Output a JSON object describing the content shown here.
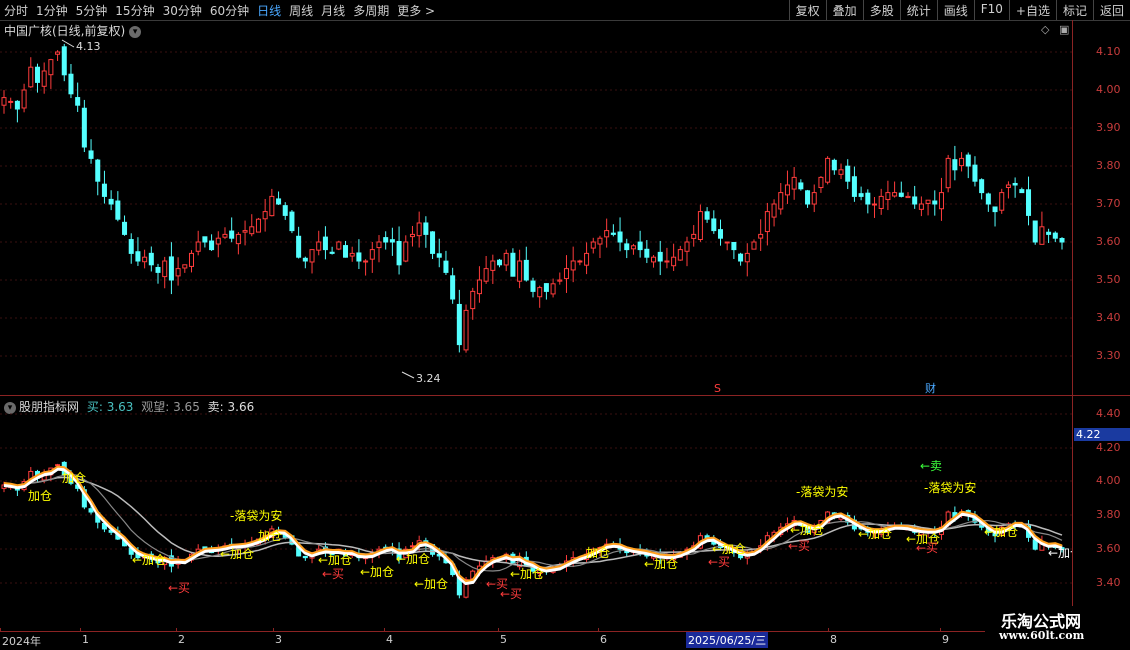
{
  "toolbar": {
    "periods": [
      "分时",
      "1分钟",
      "5分钟",
      "15分钟",
      "30分钟",
      "60分钟",
      "日线",
      "周线",
      "月线",
      "多周期",
      "更多 >"
    ],
    "active": "日线",
    "buttons": [
      "复权",
      "叠加",
      "多股",
      "统计",
      "画线",
      "F10",
      "+自选",
      "标记",
      "返回"
    ]
  },
  "main_panel": {
    "title": "中国广核(日线,前复权)",
    "high_label": "4.13",
    "low_label": "3.24",
    "marker_s": "S",
    "marker_cai": "财",
    "y_ticks": [
      "4.10",
      "4.00",
      "3.90",
      "3.80",
      "3.70",
      "3.60",
      "3.50",
      "3.40",
      "3.30"
    ]
  },
  "indicator_panel": {
    "name": "股朋指标网",
    "buy_label": "买: 3.63",
    "watch_label": "观望: 3.65",
    "sell_label": "卖: 3.66",
    "current_value": "4.22",
    "y_ticks": [
      "4.40",
      "4.20",
      "4.00",
      "3.80",
      "3.60",
      "3.40"
    ],
    "annotations": {
      "jiacang": "加仓",
      "arrow_jiacang": "←加仓",
      "arrow_buy": "←买",
      "arrow_sell": "←卖",
      "bag": "-落袋为安"
    }
  },
  "x_axis": {
    "labels": [
      "2024年",
      "1",
      "2",
      "3",
      "4",
      "5",
      "6",
      "8",
      "9"
    ],
    "highlight_date": "2025/06/25/三"
  },
  "watermark": {
    "line1": "乐淘公式网",
    "line2": "www.60lt.com"
  },
  "colors": {
    "up": "#ff3c3c",
    "down": "#54ffff",
    "axis": "#c83c3c",
    "annotation": "#ffff00",
    "buy_marker": "#ff3c3c",
    "sell_marker": "#3cff3c"
  },
  "chart_data": {
    "type": "candlestick",
    "ylim": [
      3.2,
      4.15
    ],
    "close_series": [
      3.98,
      3.97,
      3.95,
      4.0,
      4.06,
      4.02,
      4.05,
      4.08,
      4.1,
      4.04,
      3.99,
      3.96,
      3.85,
      3.82,
      3.76,
      3.72,
      3.7,
      3.66,
      3.62,
      3.57,
      3.55,
      3.56,
      3.54,
      3.52,
      3.55,
      3.5,
      3.53,
      3.54,
      3.57,
      3.6,
      3.6,
      3.58,
      3.61,
      3.62,
      3.61,
      3.62,
      3.63,
      3.64,
      3.66,
      3.68,
      3.72,
      3.7,
      3.67,
      3.63,
      3.56,
      3.55,
      3.58,
      3.6,
      3.58,
      3.57,
      3.6,
      3.56,
      3.57,
      3.55,
      3.55,
      3.58,
      3.6,
      3.6,
      3.6,
      3.54,
      3.6,
      3.62,
      3.65,
      3.62,
      3.57,
      3.56,
      3.52,
      3.45,
      3.33,
      3.42,
      3.47,
      3.5,
      3.53,
      3.55,
      3.54,
      3.57,
      3.51,
      3.55,
      3.5,
      3.47,
      3.48,
      3.47,
      3.49,
      3.5,
      3.53,
      3.55,
      3.55,
      3.57,
      3.6,
      3.61,
      3.63,
      3.62,
      3.6,
      3.58,
      3.59,
      3.58,
      3.56,
      3.56,
      3.55,
      3.55,
      3.56,
      3.58,
      3.6,
      3.62,
      3.68,
      3.66,
      3.63,
      3.61,
      3.6,
      3.58,
      3.55,
      3.57,
      3.6,
      3.62,
      3.68,
      3.7,
      3.73,
      3.75,
      3.77,
      3.74,
      3.7,
      3.73,
      3.77,
      3.82,
      3.79,
      3.79,
      3.76,
      3.72,
      3.72,
      3.7,
      3.7,
      3.72,
      3.73,
      3.73,
      3.72,
      3.72,
      3.7,
      3.7,
      3.71,
      3.7,
      3.73,
      3.82,
      3.79,
      3.82,
      3.8,
      3.76,
      3.73,
      3.7,
      3.68,
      3.73,
      3.75,
      3.75,
      3.73,
      3.67,
      3.6,
      3.64,
      3.62,
      3.61,
      3.6
    ]
  }
}
